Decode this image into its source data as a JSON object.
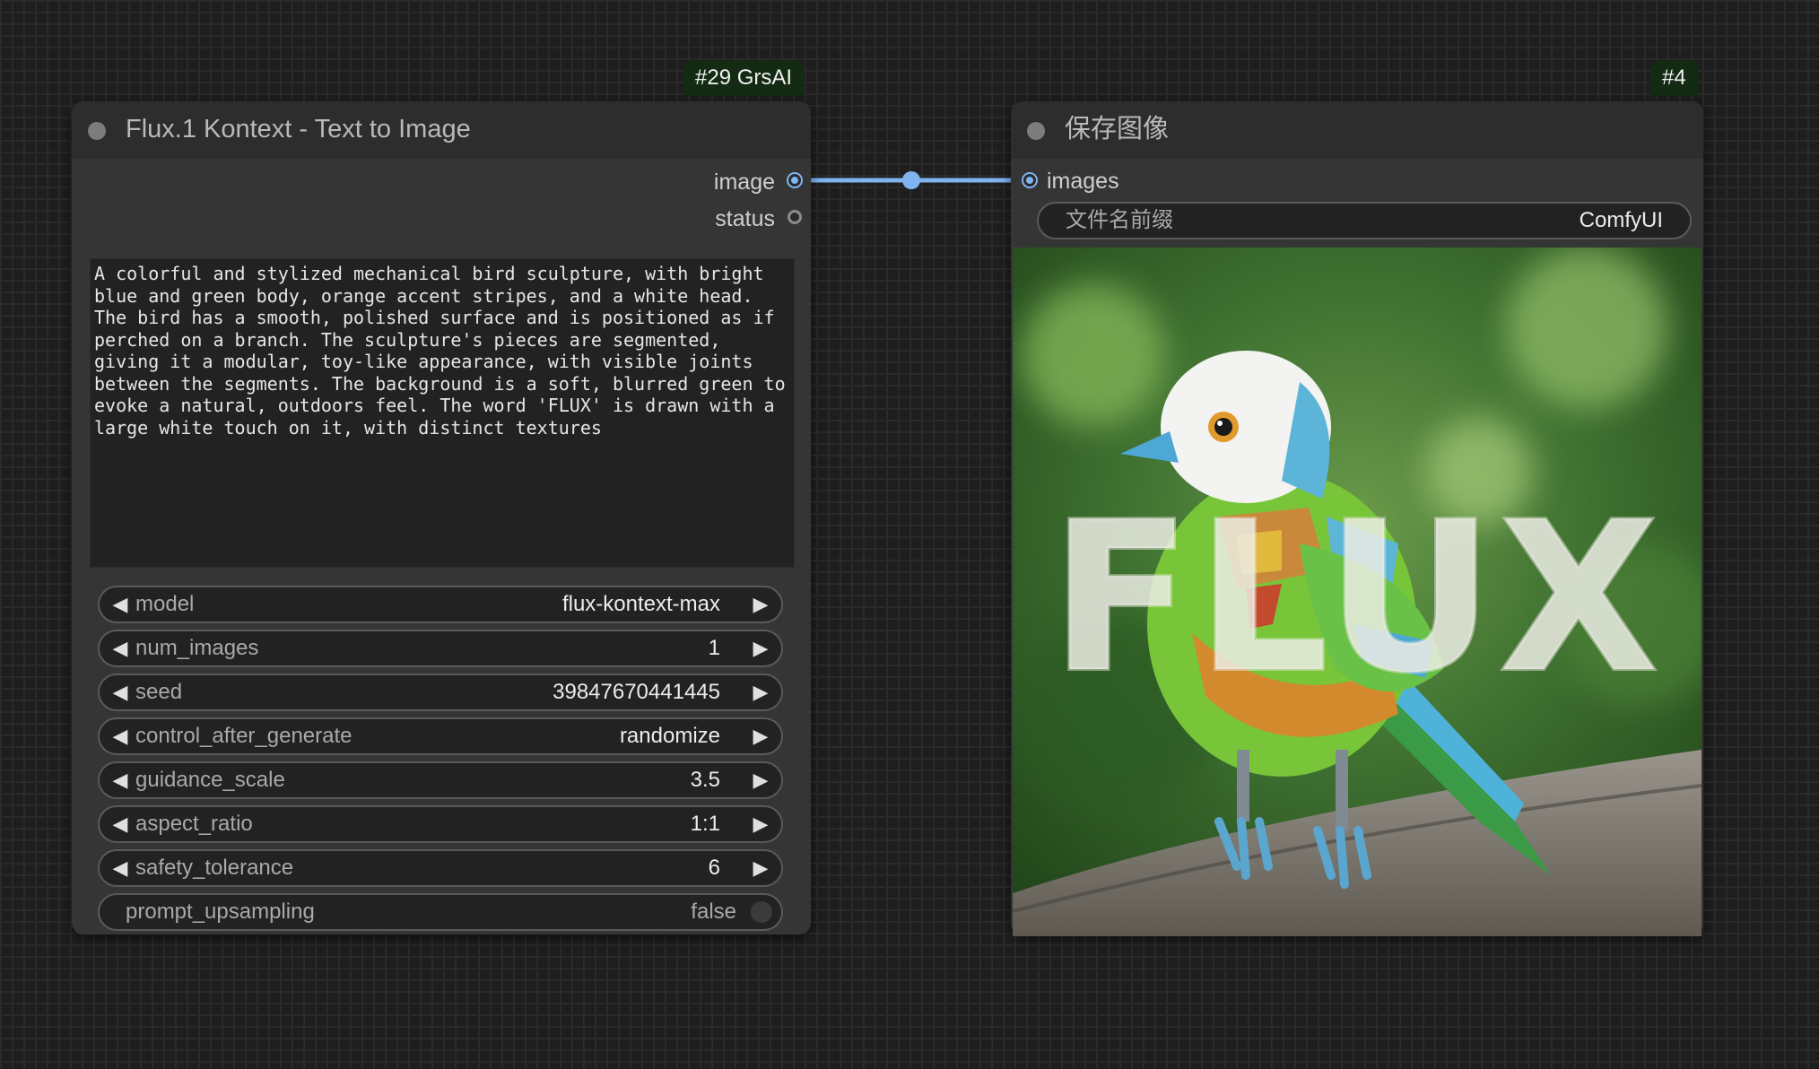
{
  "colors": {
    "canvas_bg": "#1e1e1e",
    "node_bg": "#353535",
    "badge_bg": "#132a13",
    "link": "#7fb4f0"
  },
  "nodes": {
    "text_to_image": {
      "badge": "#29 GrsAI",
      "title": "Flux.1 Kontext - Text to Image",
      "outputs": [
        {
          "label": "image"
        },
        {
          "label": "status"
        }
      ],
      "prompt": "A colorful and stylized mechanical bird sculpture, with bright blue and green body, orange accent stripes, and a white head. The bird has a smooth, polished surface and is positioned as if perched on a branch. The sculpture's pieces are segmented, giving it a modular, toy-like appearance, with visible joints between the segments. The background is a soft, blurred green to evoke a natural, outdoors feel. The word 'FLUX' is drawn with a large white touch on it, with distinct textures",
      "widgets": [
        {
          "label": "model",
          "value": "flux-kontext-max"
        },
        {
          "label": "num_images",
          "value": "1"
        },
        {
          "label": "seed",
          "value": "39847670441445"
        },
        {
          "label": "control_after_generate",
          "value": "randomize"
        },
        {
          "label": "guidance_scale",
          "value": "3.5"
        },
        {
          "label": "aspect_ratio",
          "value": "1:1"
        },
        {
          "label": "safety_tolerance",
          "value": "6"
        }
      ],
      "toggle": {
        "label": "prompt_upsampling",
        "value": "false"
      }
    },
    "save_image": {
      "badge": "#4",
      "title": "保存图像",
      "input": {
        "label": "images"
      },
      "filename": {
        "label": "文件名前缀",
        "value": "ComfyUI"
      },
      "preview": {
        "overlay_text": "FLUX",
        "icon": "mechanical-bird-image"
      }
    }
  }
}
